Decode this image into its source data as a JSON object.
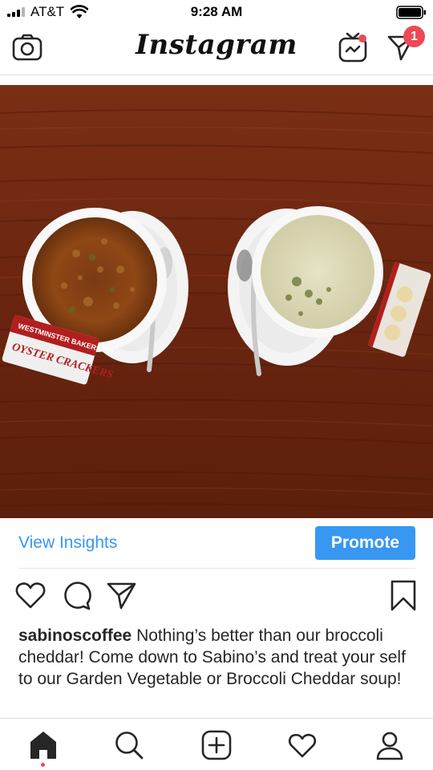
{
  "status_bar": {
    "carrier": "AT&T",
    "time": "9:28 AM",
    "icons": [
      "signal-icon",
      "wifi-icon",
      "battery-icon"
    ]
  },
  "header": {
    "logo": "Instagram",
    "icons": [
      "camera-icon",
      "igtv-icon",
      "direct-message-icon"
    ],
    "dm_badge_count": "1",
    "accent_color": "#ed4956"
  },
  "post": {
    "photo_icon": "food-photo",
    "insights": {
      "view_insights_label": "View Insights",
      "promote_label": "Promote",
      "link_color": "#3897f0"
    },
    "actions": [
      "heart-icon",
      "comment-icon",
      "share-icon",
      "bookmark-icon"
    ],
    "caption": {
      "username": "sabinoscoffee",
      "text": "Nothing’s better than our broccoli cheddar! Come down to Sabino’s and treat your self to our Garden Vegetable or Broccoli Cheddar soup!"
    },
    "photo_text": {
      "cracker_brand": "WESTMINSTER BAKERS CO",
      "cracker_label": "OYSTER CRACKERS"
    }
  },
  "bottom_nav": {
    "items": [
      "home-icon",
      "search-icon",
      "new-post-icon",
      "activity-icon",
      "profile-icon"
    ]
  }
}
